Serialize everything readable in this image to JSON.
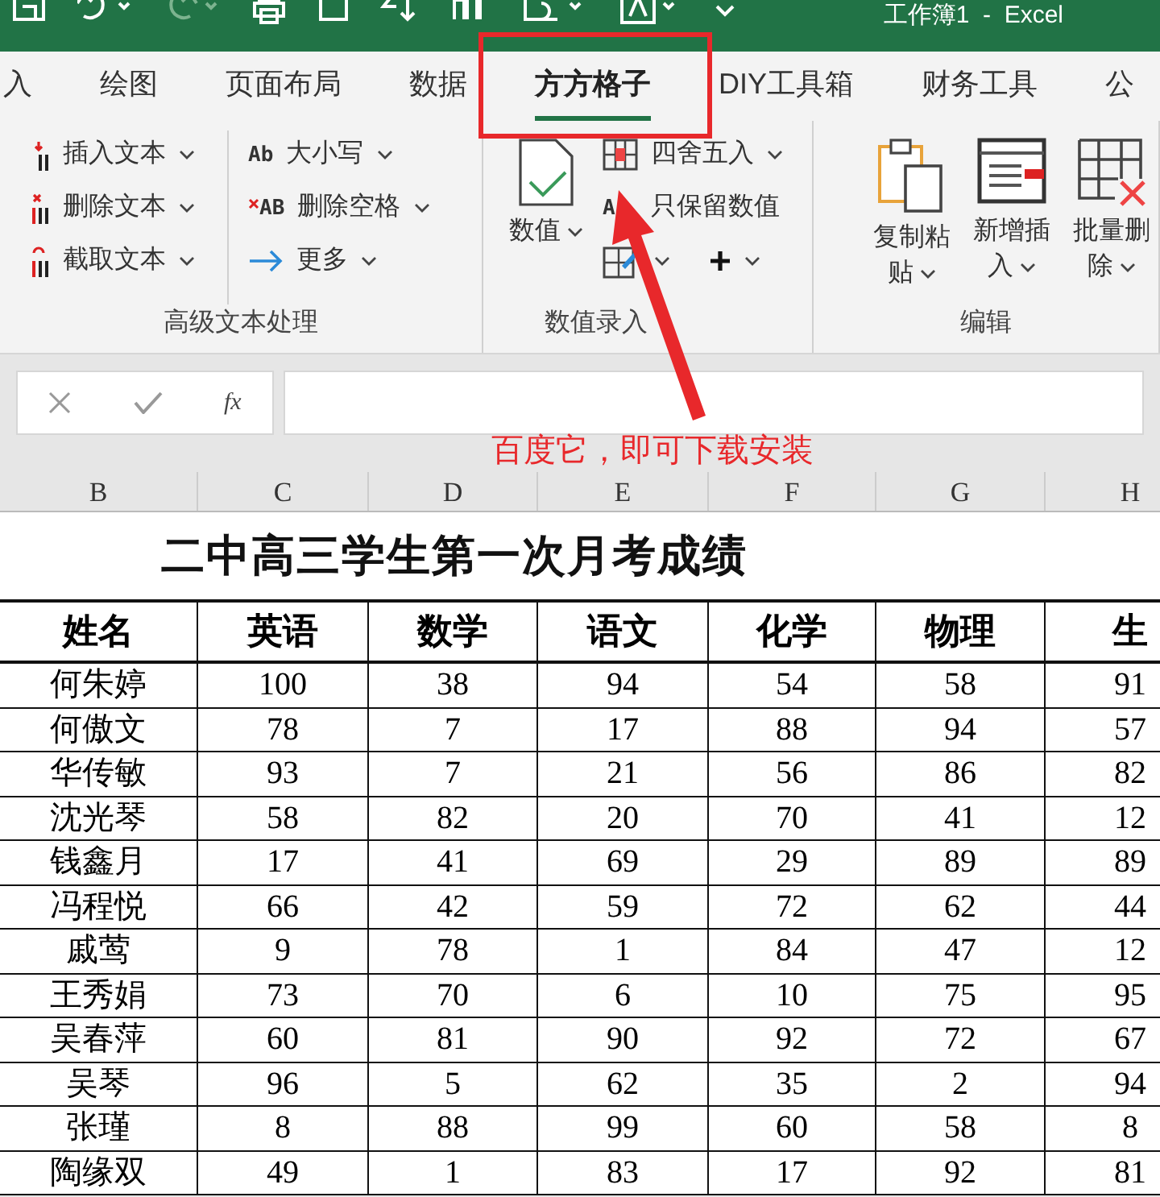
{
  "title_bar": {
    "title": "工作簿1  -  Excel"
  },
  "tabs": [
    {
      "label": "入",
      "selected": false
    },
    {
      "label": "绘图",
      "selected": false
    },
    {
      "label": "页面布局",
      "selected": false
    },
    {
      "label": "数据",
      "selected": false
    },
    {
      "label": "方方格子",
      "selected": true
    },
    {
      "label": "DIY工具箱",
      "selected": false
    },
    {
      "label": "财务工具",
      "selected": false
    },
    {
      "label": "公",
      "selected": false
    }
  ],
  "ribbon": {
    "groups": [
      {
        "label": "高级文本处理",
        "items": [
          {
            "kind": "small",
            "label": "插入文本",
            "dropdown": true
          },
          {
            "kind": "small",
            "label": "删除文本",
            "dropdown": true
          },
          {
            "kind": "small",
            "label": "截取文本",
            "dropdown": true
          },
          {
            "kind": "small",
            "label": "大小写",
            "dropdown": true,
            "icon_text": "Ab"
          },
          {
            "kind": "small",
            "label": "删除空格",
            "dropdown": true,
            "icon_text": "AB"
          },
          {
            "kind": "small",
            "label": "更多",
            "dropdown": true
          }
        ]
      },
      {
        "label": "数值录入",
        "items": [
          {
            "kind": "large",
            "label": "数值",
            "dropdown": true
          },
          {
            "kind": "small",
            "label": "四舍五入",
            "dropdown": true
          },
          {
            "kind": "small",
            "label": "只保留数值",
            "dropdown": false,
            "icon_text": "A"
          },
          {
            "kind": "small",
            "dropdown": true
          },
          {
            "kind": "small",
            "dropdown": true
          }
        ]
      },
      {
        "label": "编辑",
        "items": [
          {
            "kind": "large",
            "label": "复制粘贴",
            "dropdown": true
          },
          {
            "kind": "large",
            "label": "新增插入",
            "dropdown": true
          },
          {
            "kind": "large",
            "label": "批量删除",
            "dropdown": true
          }
        ]
      }
    ]
  },
  "formula_bar": {
    "function_label": "fx"
  },
  "annotation": {
    "text": "百度它，即可下载安装"
  },
  "column_headers": [
    "B",
    "C",
    "D",
    "E",
    "F",
    "G",
    "H"
  ],
  "sheet": {
    "title": "二中高三学生第一次月考成绩",
    "columns": [
      "姓名",
      "英语",
      "数学",
      "语文",
      "化学",
      "物理",
      "生"
    ],
    "rows": [
      [
        "何朱婷",
        "100",
        "38",
        "94",
        "54",
        "58",
        "91"
      ],
      [
        "何傲文",
        "78",
        "7",
        "17",
        "88",
        "94",
        "57"
      ],
      [
        "华传敏",
        "93",
        "7",
        "21",
        "56",
        "86",
        "82"
      ],
      [
        "沈光琴",
        "58",
        "82",
        "20",
        "70",
        "41",
        "12"
      ],
      [
        "钱鑫月",
        "17",
        "41",
        "69",
        "29",
        "89",
        "89"
      ],
      [
        "冯程悦",
        "66",
        "42",
        "59",
        "72",
        "62",
        "44"
      ],
      [
        "戚莺",
        "9",
        "78",
        "1",
        "84",
        "47",
        "12"
      ],
      [
        "王秀娟",
        "73",
        "70",
        "6",
        "10",
        "75",
        "95"
      ],
      [
        "吴春萍",
        "60",
        "81",
        "90",
        "92",
        "72",
        "67"
      ],
      [
        "吴琴",
        "96",
        "5",
        "62",
        "35",
        "2",
        "94"
      ],
      [
        "张瑾",
        "8",
        "88",
        "99",
        "60",
        "58",
        "8"
      ],
      [
        "陶缘双",
        "49",
        "1",
        "83",
        "17",
        "92",
        "81"
      ]
    ]
  }
}
